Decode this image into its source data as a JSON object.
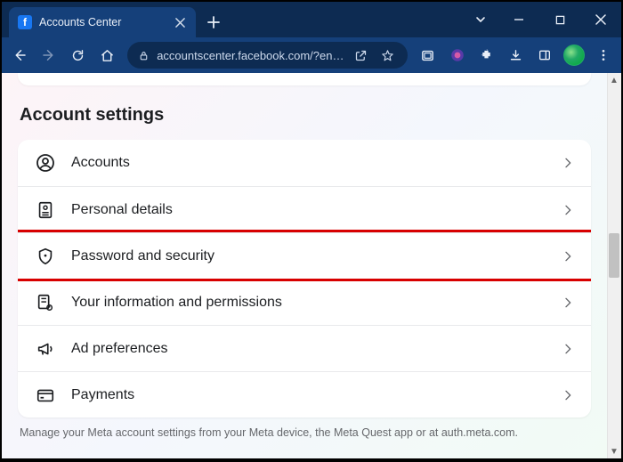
{
  "browser": {
    "tab_title": "Accounts Center",
    "url_display": "accountscenter.facebook.com/?en…"
  },
  "page": {
    "section_title": "Account settings",
    "items": [
      {
        "label": "Accounts"
      },
      {
        "label": "Personal details"
      },
      {
        "label": "Password and security"
      },
      {
        "label": "Your information and permissions"
      },
      {
        "label": "Ad preferences"
      },
      {
        "label": "Payments"
      }
    ],
    "footer": "Manage your Meta account settings from your Meta device, the Meta Quest app or at auth.meta.com."
  }
}
